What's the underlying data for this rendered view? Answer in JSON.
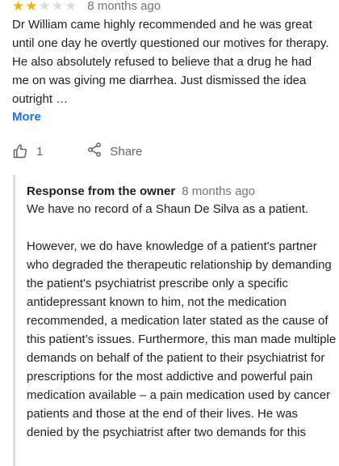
{
  "review": {
    "rating": 2,
    "max_rating": 5,
    "time": "8 months ago",
    "text": "Dr William came highly recommended and he was great until one day he overtly questioned our motives for therapy. He also absolutely refused to believe that a drug he had me on was giving me diarrhea. Just dismissed the idea outright …",
    "more_label": "More",
    "like_count": "1",
    "share_label": "Share",
    "icons": {
      "like": "thumbs-up-icon",
      "share": "share-icon",
      "star": "star-icon"
    },
    "colors": {
      "star_on": "#f4b400",
      "star_off": "#dadce0",
      "link": "#1a73e8"
    }
  },
  "owner_response": {
    "title": "Response from the owner",
    "time": "8 months ago",
    "paragraphs": [
      "We have no record of a Shaun De Silva as a patient.",
      "However, we do have knowledge of a patient's partner who degraded the therapeutic relationship by demanding the patient's psychiatrist prescribe only a specific antidepressant known to him, not the medication recommended, a medication later stated as the cause of this patient’s issues.  Furthermore, this man made multiple demands on behalf of the patient to their psychiatrist for prescriptions for the most addictive and powerful pain medication available – a pain medication used by cancer patients and those at the end of their lives. He was denied by the psychiatrist after two demands for this"
    ]
  }
}
